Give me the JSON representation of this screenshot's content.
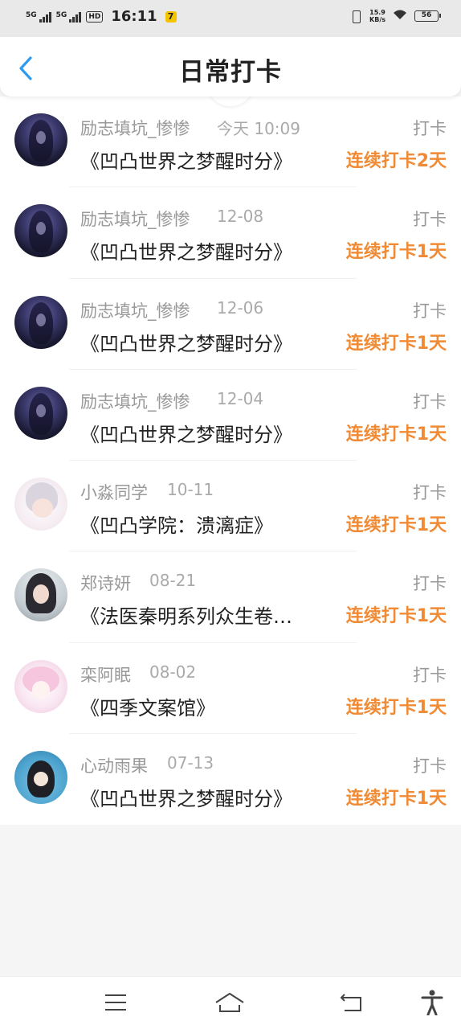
{
  "status_bar": {
    "signal1": "5G",
    "signal2": "5G",
    "hd": "HD",
    "time": "16:11",
    "app_indicator": "7",
    "speed_value": "15.9",
    "speed_unit": "KB/s",
    "battery": "56"
  },
  "header": {
    "title": "日常打卡",
    "back_icon": "chevron-left-icon",
    "accent_color": "#2f9bf0"
  },
  "checkins": [
    {
      "user": "励志填坑_惨惨",
      "date": "今天 10:09",
      "action": "打卡",
      "book": "《凹凸世界之梦醒时分》",
      "streak": "连续打卡2天",
      "avatar": "dark"
    },
    {
      "user": "励志填坑_惨惨",
      "date": "12-08",
      "action": "打卡",
      "book": "《凹凸世界之梦醒时分》",
      "streak": "连续打卡1天",
      "avatar": "dark"
    },
    {
      "user": "励志填坑_惨惨",
      "date": "12-06",
      "action": "打卡",
      "book": "《凹凸世界之梦醒时分》",
      "streak": "连续打卡1天",
      "avatar": "dark"
    },
    {
      "user": "励志填坑_惨惨",
      "date": "12-04",
      "action": "打卡",
      "book": "《凹凸世界之梦醒时分》",
      "streak": "连续打卡1天",
      "avatar": "dark"
    },
    {
      "user": "小淼同学",
      "date": "10-11",
      "action": "打卡",
      "book": "《凹凸学院：溃漓症》",
      "streak": "连续打卡1天",
      "avatar": "white"
    },
    {
      "user": "郑诗妍",
      "date": "08-21",
      "action": "打卡",
      "book": "《法医秦明系列众生卷…",
      "streak": "连续打卡1天",
      "avatar": "girl"
    },
    {
      "user": "栾阿眠",
      "date": "08-02",
      "action": "打卡",
      "book": "《四季文案馆》",
      "streak": "连续打卡1天",
      "avatar": "pink"
    },
    {
      "user": "心动雨果",
      "date": "07-13",
      "action": "打卡",
      "book": "《凹凸世界之梦醒时分》",
      "streak": "连续打卡1天",
      "avatar": "blue"
    }
  ],
  "streak_color": "#f08a35",
  "navbar": {
    "items": [
      "menu-icon",
      "home-icon",
      "back-icon",
      "accessibility-icon"
    ]
  }
}
